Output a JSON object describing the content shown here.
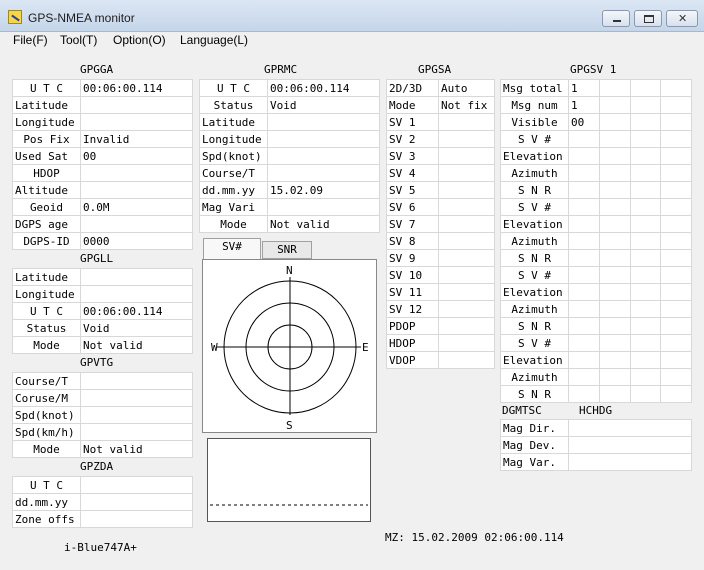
{
  "window": {
    "title": "GPS-NMEA monitor",
    "app_icon": "satellite-app-icon",
    "controls": {
      "close_glyph": "✕"
    }
  },
  "menu": [
    "File(F)",
    "Tool(T)",
    "Option(O)",
    "Language(L)"
  ],
  "gpgga": {
    "title": "GPGGA",
    "rows": [
      {
        "label": "U T C",
        "value": "00:06:00.114"
      },
      {
        "label": "Latitude",
        "value": ""
      },
      {
        "label": "Longitude",
        "value": ""
      },
      {
        "label": "Pos Fix",
        "value": "Invalid"
      },
      {
        "label": "Used Sat",
        "value": "00"
      },
      {
        "label": "HDOP",
        "value": ""
      },
      {
        "label": "Altitude",
        "value": ""
      },
      {
        "label": "Geoid",
        "value": "0.0M"
      },
      {
        "label": "DGPS age",
        "value": ""
      },
      {
        "label": "DGPS-ID",
        "value": "0000"
      }
    ]
  },
  "gpgll": {
    "title": "GPGLL",
    "rows": [
      {
        "label": "Latitude",
        "value": ""
      },
      {
        "label": "Longitude",
        "value": ""
      },
      {
        "label": "U T C",
        "value": "00:06:00.114"
      },
      {
        "label": "Status",
        "value": "Void"
      },
      {
        "label": "Mode",
        "value": "Not valid"
      }
    ]
  },
  "gpvtg": {
    "title": "GPVTG",
    "rows": [
      {
        "label": "Course/T",
        "value": ""
      },
      {
        "label": "Coruse/M",
        "value": ""
      },
      {
        "label": "Spd(knot)",
        "value": ""
      },
      {
        "label": "Spd(km/h)",
        "value": ""
      },
      {
        "label": "Mode",
        "value": "Not valid"
      }
    ]
  },
  "gpzda": {
    "title": "GPZDA",
    "rows": [
      {
        "label": "U T C",
        "value": ""
      },
      {
        "label": "dd.mm.yy",
        "value": ""
      },
      {
        "label": "Zone offs",
        "value": ""
      }
    ]
  },
  "gprmc": {
    "title": "GPRMC",
    "rows": [
      {
        "label": "U T C",
        "value": "00:06:00.114"
      },
      {
        "label": "Status",
        "value": "Void"
      },
      {
        "label": "Latitude",
        "value": ""
      },
      {
        "label": "Longitude",
        "value": ""
      },
      {
        "label": "Spd(knot)",
        "value": ""
      },
      {
        "label": "Course/T",
        "value": ""
      },
      {
        "label": "dd.mm.yy",
        "value": "15.02.09"
      },
      {
        "label": "Mag Vari",
        "value": ""
      },
      {
        "label": "Mode",
        "value": "Not valid"
      }
    ]
  },
  "gpgsa": {
    "title": "GPGSA",
    "rows": [
      {
        "label": "2D/3D",
        "value": "Auto"
      },
      {
        "label": "Mode",
        "value": "Not fix"
      },
      {
        "label": "SV  1",
        "value": ""
      },
      {
        "label": "SV  2",
        "value": ""
      },
      {
        "label": "SV  3",
        "value": ""
      },
      {
        "label": "SV  4",
        "value": ""
      },
      {
        "label": "SV  5",
        "value": ""
      },
      {
        "label": "SV  6",
        "value": ""
      },
      {
        "label": "SV  7",
        "value": ""
      },
      {
        "label": "SV  8",
        "value": ""
      },
      {
        "label": "SV  9",
        "value": ""
      },
      {
        "label": "SV 10",
        "value": ""
      },
      {
        "label": "SV 11",
        "value": ""
      },
      {
        "label": "SV 12",
        "value": ""
      },
      {
        "label": "PDOP",
        "value": ""
      },
      {
        "label": "HDOP",
        "value": ""
      },
      {
        "label": "VDOP",
        "value": ""
      }
    ]
  },
  "gpgsv": {
    "title": "GPGSV 1",
    "header_rows": [
      {
        "label": "Msg total",
        "value": "1"
      },
      {
        "label": "Msg num",
        "value": "1"
      },
      {
        "label": "Visible",
        "value": "00"
      }
    ],
    "sat_labels": [
      "S V #",
      "Elevation",
      "Azimuth",
      "S N R"
    ],
    "sat_block_count": 4
  },
  "dgmtsc": {
    "title": "DGMTSC",
    "title2": "HCHDG",
    "rows": [
      {
        "label": "Mag Dir.",
        "value": ""
      },
      {
        "label": "Mag Dev.",
        "value": ""
      },
      {
        "label": "Mag Var.",
        "value": ""
      }
    ]
  },
  "tabs": [
    "SV#",
    "SNR"
  ],
  "sky": {
    "north": "N",
    "south": "S",
    "east": "E",
    "west": "W"
  },
  "device": "i-Blue747A+",
  "mz": "MZ: 15.02.2009 02:06:00.114"
}
